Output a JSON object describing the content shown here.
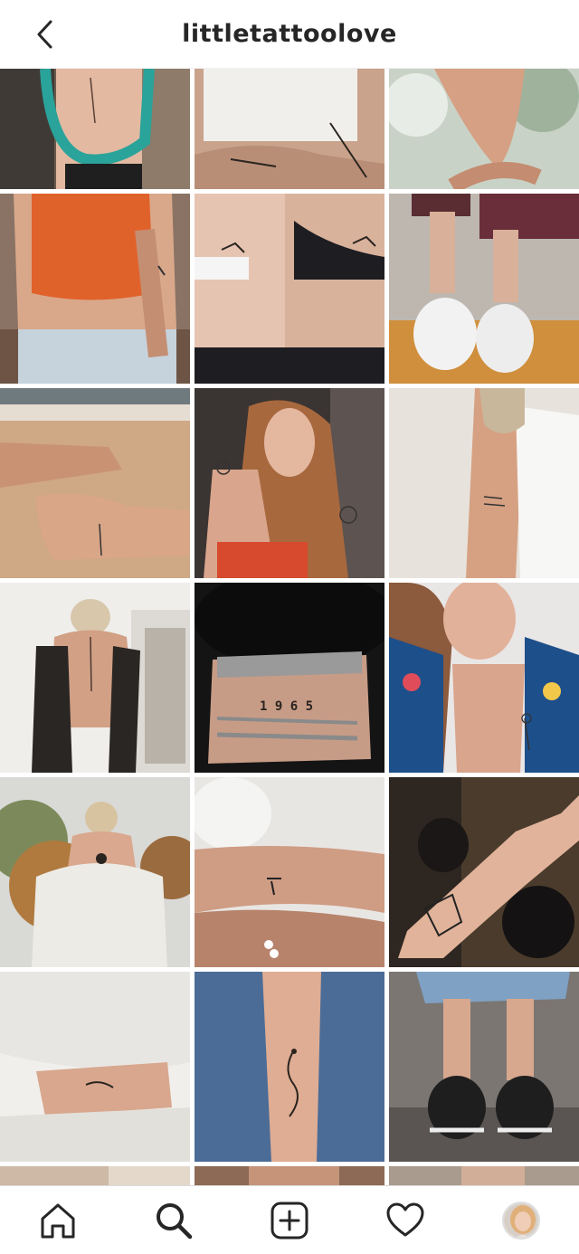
{
  "header": {
    "title": "littletattoolove",
    "back_icon": "chevron-left-icon"
  },
  "grid": {
    "columns": 3,
    "posts": [
      {
        "id": 1,
        "subject": "back tattoo with turquoise lei"
      },
      {
        "id": 2,
        "subject": "arm tattoos white top"
      },
      {
        "id": 3,
        "subject": "holding hands ring"
      },
      {
        "id": 4,
        "subject": "orange tank top arm tattoos"
      },
      {
        "id": 5,
        "subject": "matching rib tattoos"
      },
      {
        "id": 6,
        "subject": "ankle tattoos white sneakers"
      },
      {
        "id": 7,
        "subject": "ankle tattoo on beach sand"
      },
      {
        "id": 8,
        "subject": "flower arm tattoos"
      },
      {
        "id": 9,
        "subject": "arm script tattoo white top"
      },
      {
        "id": 10,
        "subject": "spine back tattoo"
      },
      {
        "id": 11,
        "subject": "wrist 1965 tattoo bracelets",
        "visible_text": "1 9 6 5"
      },
      {
        "id": 12,
        "subject": "rose wrist tattoo floral top"
      },
      {
        "id": 13,
        "subject": "neck tattoo autumn trees"
      },
      {
        "id": 14,
        "subject": "palm tree ankle tattoo"
      },
      {
        "id": 15,
        "subject": "geometric dog forearm tattoo"
      },
      {
        "id": 16,
        "subject": "arm tattoo white sweater"
      },
      {
        "id": 17,
        "subject": "snake sternum tattoo denim jacket"
      },
      {
        "id": 18,
        "subject": "ankle tattoo converse sneakers"
      }
    ]
  },
  "bottom_nav": {
    "items": [
      {
        "name": "home",
        "icon": "home-icon"
      },
      {
        "name": "search",
        "icon": "search-icon",
        "active": true
      },
      {
        "name": "new-post",
        "icon": "plus-square-icon"
      },
      {
        "name": "activity",
        "icon": "heart-icon"
      },
      {
        "name": "profile",
        "icon": "avatar"
      }
    ]
  },
  "colors": {
    "text_primary": "#262626",
    "divider": "#dbdbdb",
    "background": "#ffffff"
  }
}
